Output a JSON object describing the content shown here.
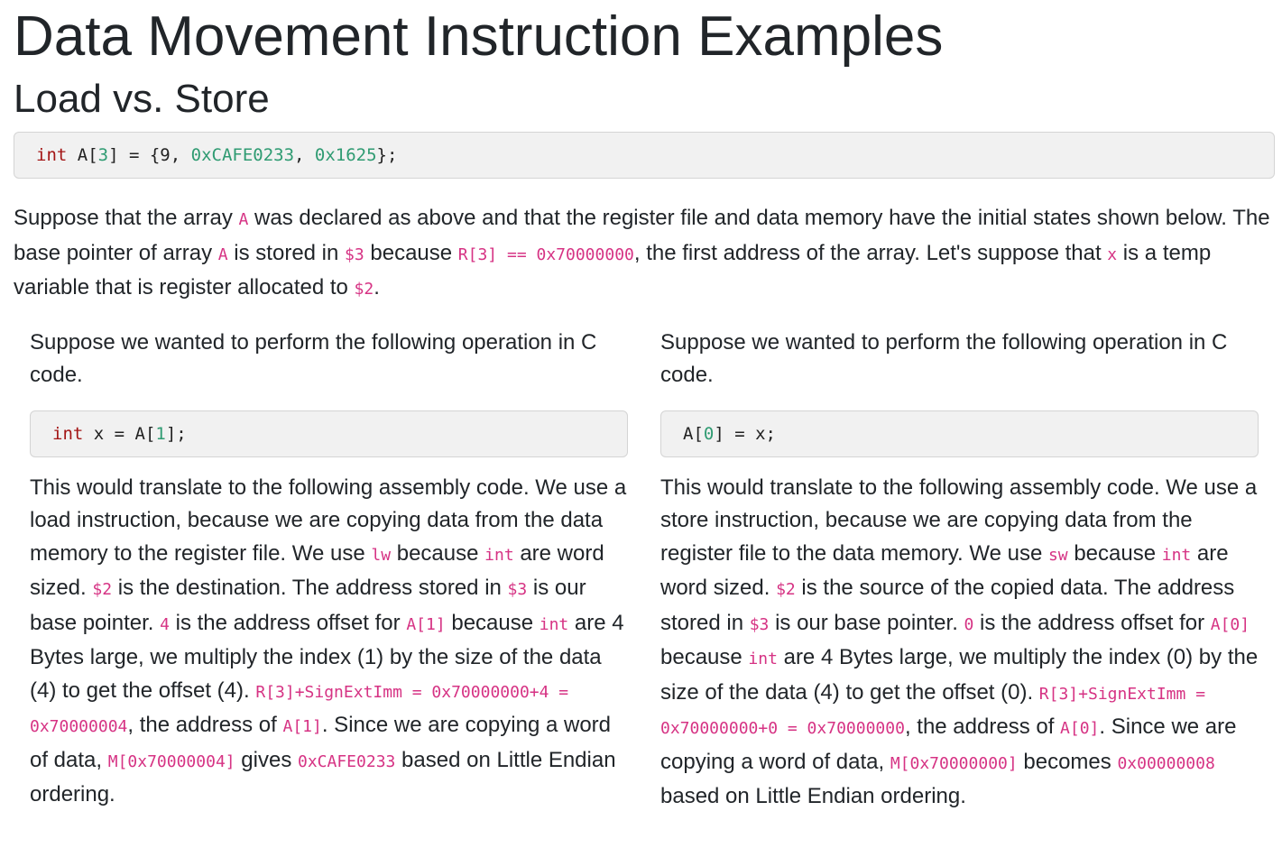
{
  "title": "Data Movement Instruction Examples",
  "subtitle": "Load vs. Store",
  "top_code": [
    {
      "t": "int",
      "c": "kw"
    },
    {
      "t": " A["
    },
    {
      "t": "3",
      "c": "num"
    },
    {
      "t": "] = {9, "
    },
    {
      "t": "0xCAFE0233",
      "c": "num"
    },
    {
      "t": ", "
    },
    {
      "t": "0x1625",
      "c": "num"
    },
    {
      "t": "};"
    }
  ],
  "intro": [
    {
      "t": "Suppose that the array "
    },
    {
      "t": "A",
      "code": true
    },
    {
      "t": " was declared as above and that the register file and data memory have the initial states shown below. The base pointer of array "
    },
    {
      "t": "A",
      "code": true
    },
    {
      "t": " is stored in "
    },
    {
      "t": "$3",
      "code": true
    },
    {
      "t": " because "
    },
    {
      "t": "R[3] == 0x70000000",
      "code": true
    },
    {
      "t": ", the first address of the array. Let's suppose that "
    },
    {
      "t": "x",
      "code": true
    },
    {
      "t": " is a temp variable that is register allocated to "
    },
    {
      "t": "$2",
      "code": true
    },
    {
      "t": "."
    }
  ],
  "columns": [
    {
      "lead": [
        {
          "t": "Suppose we wanted to perform the following operation in C code."
        }
      ],
      "code": [
        {
          "t": "int",
          "c": "kw"
        },
        {
          "t": " x = A["
        },
        {
          "t": "1",
          "c": "num"
        },
        {
          "t": "];"
        }
      ],
      "body": [
        {
          "t": "This would translate to the following assembly code. We use a load instruction, because we are copying data from the data memory to the register file. We use "
        },
        {
          "t": "lw",
          "code": true
        },
        {
          "t": " because "
        },
        {
          "t": "int",
          "code": true
        },
        {
          "t": " are word sized. "
        },
        {
          "t": "$2",
          "code": true
        },
        {
          "t": " is the destination. The address stored in "
        },
        {
          "t": "$3",
          "code": true
        },
        {
          "t": " is our base pointer. "
        },
        {
          "t": "4",
          "code": true
        },
        {
          "t": " is the address offset for "
        },
        {
          "t": "A[1]",
          "code": true
        },
        {
          "t": " because "
        },
        {
          "t": "int",
          "code": true
        },
        {
          "t": " are 4 Bytes large, we multiply the index (1) by the size of the data (4) to get the offset (4). "
        },
        {
          "t": "R[3]+SignExtImm = 0x70000000+4 = 0x70000004",
          "code": true
        },
        {
          "t": ", the address of "
        },
        {
          "t": "A[1]",
          "code": true
        },
        {
          "t": ". Since we are copying a word of data, "
        },
        {
          "t": "M[0x70000004]",
          "code": true
        },
        {
          "t": " gives "
        },
        {
          "t": "0xCAFE0233",
          "code": true
        },
        {
          "t": " based on Little Endian ordering."
        }
      ]
    },
    {
      "lead": [
        {
          "t": "Suppose we wanted to perform the following operation in C code."
        }
      ],
      "code": [
        {
          "t": "A["
        },
        {
          "t": "0",
          "c": "num"
        },
        {
          "t": "] = x;"
        }
      ],
      "body": [
        {
          "t": "This would translate to the following assembly code. We use a store instruction, because we are copying data from the register file to the data memory. We use "
        },
        {
          "t": "sw",
          "code": true
        },
        {
          "t": " because "
        },
        {
          "t": "int",
          "code": true
        },
        {
          "t": " are word sized. "
        },
        {
          "t": "$2",
          "code": true
        },
        {
          "t": " is the source of the copied data. The address stored in "
        },
        {
          "t": "$3",
          "code": true
        },
        {
          "t": " is our base pointer. "
        },
        {
          "t": "0",
          "code": true
        },
        {
          "t": " is the address offset for "
        },
        {
          "t": "A[0]",
          "code": true
        },
        {
          "t": " because "
        },
        {
          "t": "int",
          "code": true
        },
        {
          "t": " are 4 Bytes large, we multiply the index (0) by the size of the data (4) to get the offset (0). "
        },
        {
          "t": "R[3]+SignExtImm = 0x70000000+0 = 0x70000000",
          "code": true
        },
        {
          "t": ", the address of "
        },
        {
          "t": "A[0]",
          "code": true
        },
        {
          "t": ". Since we are copying a word of data, "
        },
        {
          "t": "M[0x70000000]",
          "code": true
        },
        {
          "t": " becomes "
        },
        {
          "t": "0x00000008",
          "code": true
        },
        {
          "t": " based on Little Endian ordering."
        }
      ]
    }
  ]
}
